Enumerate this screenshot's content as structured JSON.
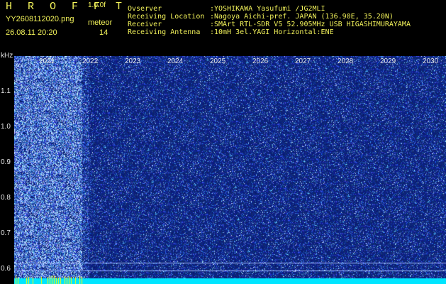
{
  "header": {
    "app_title": "H R O F F T",
    "version": "1.0.0f",
    "file_name": "YY2608112020.png",
    "date_time": "26.08.11 20:20",
    "meteor_label": "meteor",
    "meteor_count": "14"
  },
  "info": [
    {
      "label": "Ovserver",
      "value": ":YOSHIKAWA Yasufumi /JG2MLI"
    },
    {
      "label": "Receiving Location",
      "value": ":Nagoya Aichi-pref. JAPAN (136.90E, 35.20N)"
    },
    {
      "label": "Receiver",
      "value": ":SMArt RTL-SDR V5 52.905MHz USB HIGASHIMURAYAMA"
    },
    {
      "label": "Receiving Antenna",
      "value": ":10mH 3el.YAGI Horizontal:ENE"
    }
  ],
  "spectrogram": {
    "frequency_unit": "kHz",
    "y_ticks": [
      "1.1",
      "1.0",
      "0.9",
      "0.8",
      "0.7",
      "0.6"
    ],
    "y_values": [
      1.1,
      1.0,
      0.9,
      0.8,
      0.7,
      0.6
    ],
    "x_ticks": [
      "2021",
      "2022",
      "2023",
      "2024",
      "2025",
      "2026",
      "2027",
      "2028",
      "2029",
      "2030"
    ],
    "colors": {
      "background": "#000000",
      "noise_low": "#10208a",
      "noise_high": "#6fa8ff",
      "baseline": "#00e5ff",
      "marker": "#ffff00",
      "text": "#f2f25a"
    }
  }
}
